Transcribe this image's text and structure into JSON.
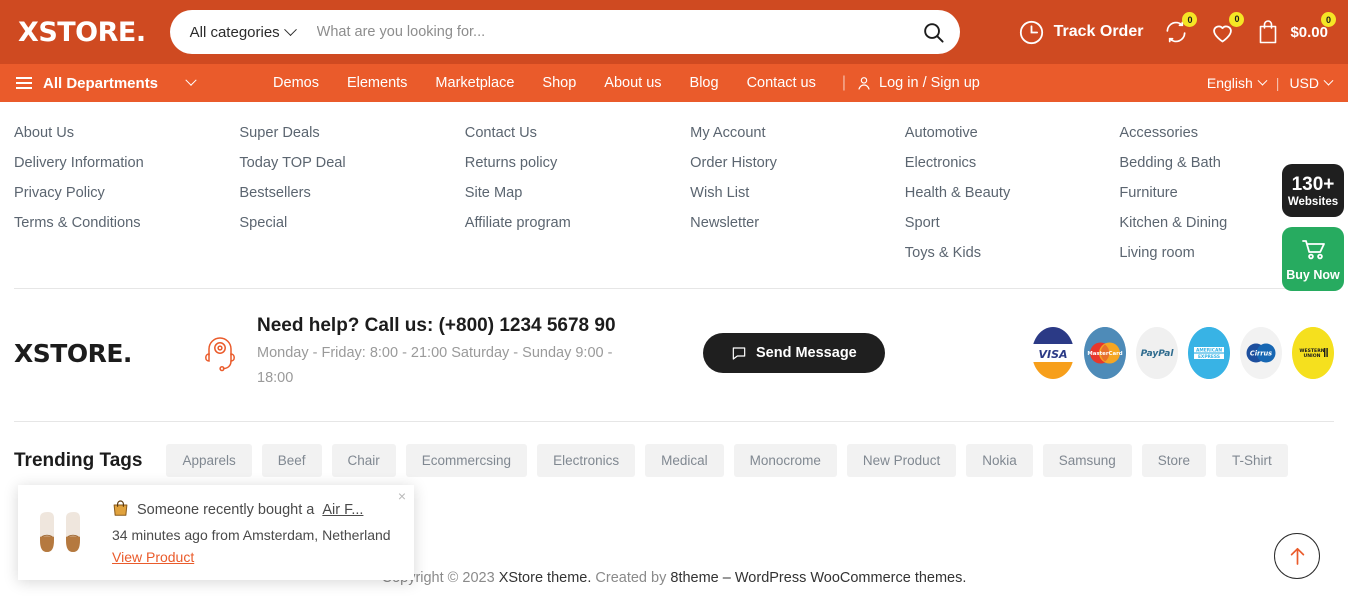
{
  "header": {
    "logo": "XSTORE.",
    "search": {
      "category_label": "All categories",
      "placeholder": "What are you looking for...",
      "value": ""
    },
    "track_order": "Track Order",
    "compare_count": "0",
    "wishlist_count": "0",
    "cart_count": "0",
    "cart_total": "$0.00"
  },
  "nav": {
    "all_departments": "All Departments",
    "links": [
      "Demos",
      "Elements",
      "Marketplace",
      "Shop",
      "About us",
      "Blog",
      "Contact us"
    ],
    "login": "Log in / Sign up",
    "language": "English",
    "currency": "USD"
  },
  "footer": {
    "columns": [
      {
        "links": [
          "About Us",
          "Delivery Information",
          "Privacy Policy",
          "Terms & Conditions"
        ]
      },
      {
        "links": [
          "Super Deals",
          "Today TOP Deal",
          "Bestsellers",
          "Special"
        ]
      },
      {
        "links": [
          "Contact Us",
          "Returns policy",
          "Site Map",
          "Affiliate program"
        ]
      },
      {
        "links": [
          "My Account",
          "Order History",
          "Wish List",
          "Newsletter"
        ]
      },
      {
        "links": [
          "Automotive",
          "Electronics",
          "Health & Beauty",
          "Sport",
          "Toys & Kids"
        ]
      },
      {
        "links": [
          "Accessories",
          "Bedding & Bath",
          "Furniture",
          "Kitchen & Dining",
          "Living room"
        ]
      }
    ],
    "brand": "XSTORE.",
    "call_title": "Need help? Call us: (+800) 1234 5678 90",
    "call_hours": "Monday - Friday: 8:00 - 21:00 Saturday - Sunday 9:00 - 18:00",
    "send_message": "Send Message",
    "payments": [
      "visa-icon",
      "mastercard-icon",
      "paypal-icon",
      "american-express-icon",
      "cirrus-icon",
      "western-union-icon"
    ],
    "copyright_prefix": "Copyright © 2023 ",
    "copyright_brand": "XStore theme.",
    "copyright_mid": " Created by ",
    "copyright_author": "8theme",
    "copyright_suffix": " – WordPress WooCommerce themes."
  },
  "tags": {
    "title": "Trending Tags",
    "items": [
      "Apparels",
      "Beef",
      "Chair",
      "Ecommercsing",
      "Electronics",
      "Medical",
      "Monocrome",
      "New Product",
      "Nokia",
      "Samsung",
      "Store",
      "T-Shirt"
    ]
  },
  "side_badges": {
    "websites_count": "130+",
    "websites_label": "Websites",
    "buy_now": "Buy Now"
  },
  "popup": {
    "message_prefix": "Someone recently bought a ",
    "product": "Air F...",
    "time_location": "34 minutes ago from Amsterdam, Netherland",
    "view_product": "View Product",
    "close": "×"
  },
  "colors": {
    "topbar": "#cf4a21",
    "navbar": "#ea5b2b",
    "accent": "#ea5b2b",
    "badge_yellow": "#f5e625",
    "dark": "#1f1f1f",
    "green": "#27ab60"
  }
}
